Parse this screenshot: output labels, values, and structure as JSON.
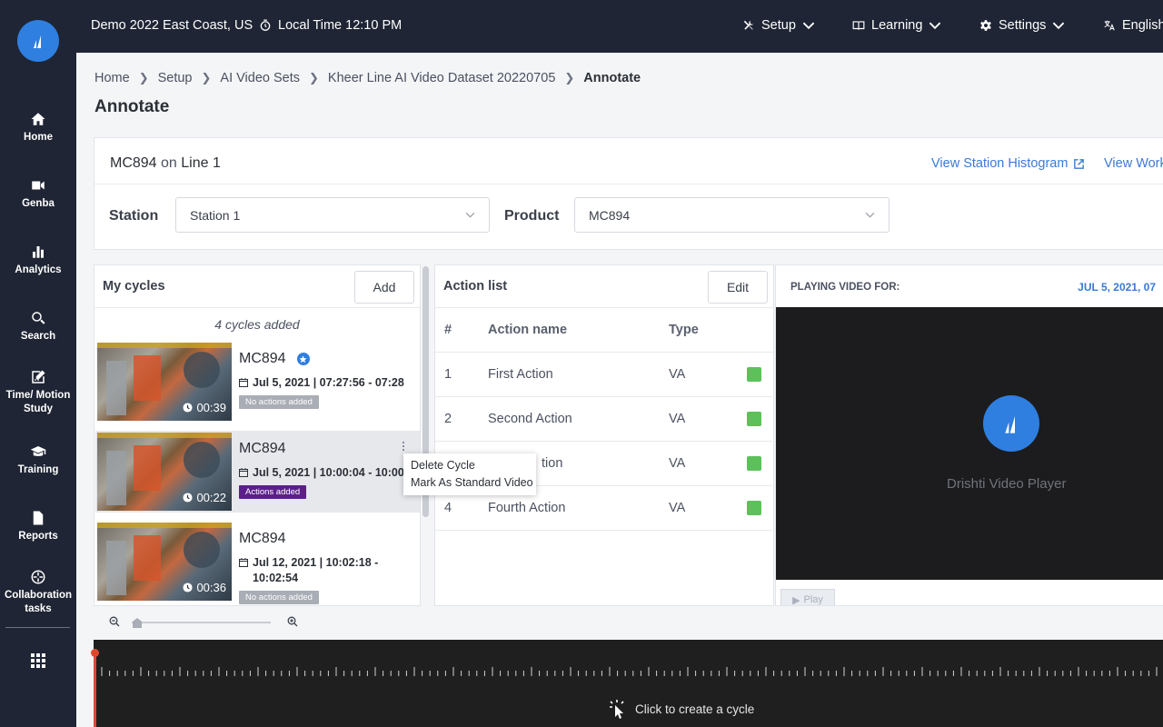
{
  "topbar": {
    "site": "Demo 2022 East Coast, US",
    "local_time": "Local Time 12:10 PM",
    "menus": [
      {
        "label": "Setup",
        "icon": "tools-icon"
      },
      {
        "label": "Learning",
        "icon": "book-icon"
      },
      {
        "label": "Settings",
        "icon": "gear-icon"
      },
      {
        "label": "English",
        "icon": "translate-icon"
      }
    ]
  },
  "sidebar": {
    "items": [
      {
        "label": "Home",
        "icon": "home-icon"
      },
      {
        "label": "Genba",
        "icon": "video-camera-icon"
      },
      {
        "label": "Analytics",
        "icon": "bar-chart-icon"
      },
      {
        "label": "Search",
        "icon": "search-icon"
      },
      {
        "label": "Time/ Motion Study",
        "icon": "edit-chart-icon"
      },
      {
        "label": "Training",
        "icon": "graduation-cap-icon"
      },
      {
        "label": "Reports",
        "icon": "document-icon"
      },
      {
        "label": "Collaboration tasks",
        "icon": "crosshair-icon"
      }
    ]
  },
  "breadcrumb": [
    "Home",
    "Setup",
    "AI Video Sets",
    "Kheer Line AI Video Dataset 20220705",
    "Annotate"
  ],
  "page_title": "Annotate",
  "filter": {
    "product_name": "MC894",
    "on_text": "on",
    "line_name": "Line 1",
    "link_histogram": "View Station Histogram",
    "link_work": "View Work",
    "station_label": "Station",
    "station_value": "Station 1",
    "product_label": "Product",
    "product_value": "MC894"
  },
  "cycles_panel": {
    "title": "My cycles",
    "add_label": "Add",
    "count_text": "4 cycles added",
    "cycles": [
      {
        "title": "MC894",
        "date": "Jul 5, 2021 | 07:27:56 - 07:28",
        "duration": "00:39",
        "tag": "No actions added",
        "standard": true
      },
      {
        "title": "MC894",
        "date": "Jul 5, 2021 | 10:00:04 - 10:00",
        "duration": "00:22",
        "tag": "Actions added",
        "standard": false
      },
      {
        "title": "MC894",
        "date": "Jul 12, 2021 | 10:02:18 - 10:02:54",
        "duration": "00:36",
        "tag": "No actions added",
        "standard": false
      }
    ],
    "context_menu": [
      "Delete Cycle",
      "Mark As Standard Video"
    ]
  },
  "action_panel": {
    "title": "Action list",
    "edit_label": "Edit",
    "columns": [
      "#",
      "Action name",
      "Type"
    ],
    "rows": [
      {
        "num": "1",
        "name": "First Action",
        "type": "VA"
      },
      {
        "num": "2",
        "name": "Second Action",
        "type": "VA"
      },
      {
        "num": "3",
        "name": "tion",
        "type": "VA"
      },
      {
        "num": "4",
        "name": "Fourth Action",
        "type": "VA"
      }
    ],
    "status_color": "#5cc15a"
  },
  "video_panel": {
    "heading": "PLAYING VIDEO FOR:",
    "date": "JUL 5, 2021, 07",
    "player_name": "Drishti Video Player",
    "play_label": "Play"
  },
  "timeline": {
    "hint": "Click to create a cycle"
  },
  "colors": {
    "sidebar_bg": "#1f2534",
    "brand_blue": "#2f7fe0",
    "link_blue": "#3b79d6",
    "actions_added_tag": "#5c1f8a",
    "playhead": "#e0482e"
  }
}
